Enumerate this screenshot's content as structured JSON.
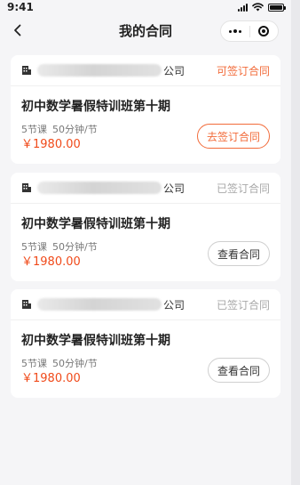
{
  "status_bar": {
    "time": "9:41"
  },
  "nav": {
    "title": "我的合同"
  },
  "colors": {
    "accent": "#f26b3a",
    "price": "#f04a1a",
    "muted": "#a8a8a8"
  },
  "contracts": [
    {
      "company_suffix": "公司",
      "status": "可签订合同",
      "course_title": "初中数学暑假特训班第十期",
      "lessons": "5节课",
      "duration": "50分钟/节",
      "price": "￥1980.00",
      "action": "去签订合同"
    },
    {
      "company_suffix": "公司",
      "status": "已签订合同",
      "course_title": "初中数学暑假特训班第十期",
      "lessons": "5节课",
      "duration": "50分钟/节",
      "price": "￥1980.00",
      "action": "查看合同"
    },
    {
      "company_suffix": "公司",
      "status": "已签订合同",
      "course_title": "初中数学暑假特训班第十期",
      "lessons": "5节课",
      "duration": "50分钟/节",
      "price": "￥1980.00",
      "action": "查看合同"
    }
  ]
}
